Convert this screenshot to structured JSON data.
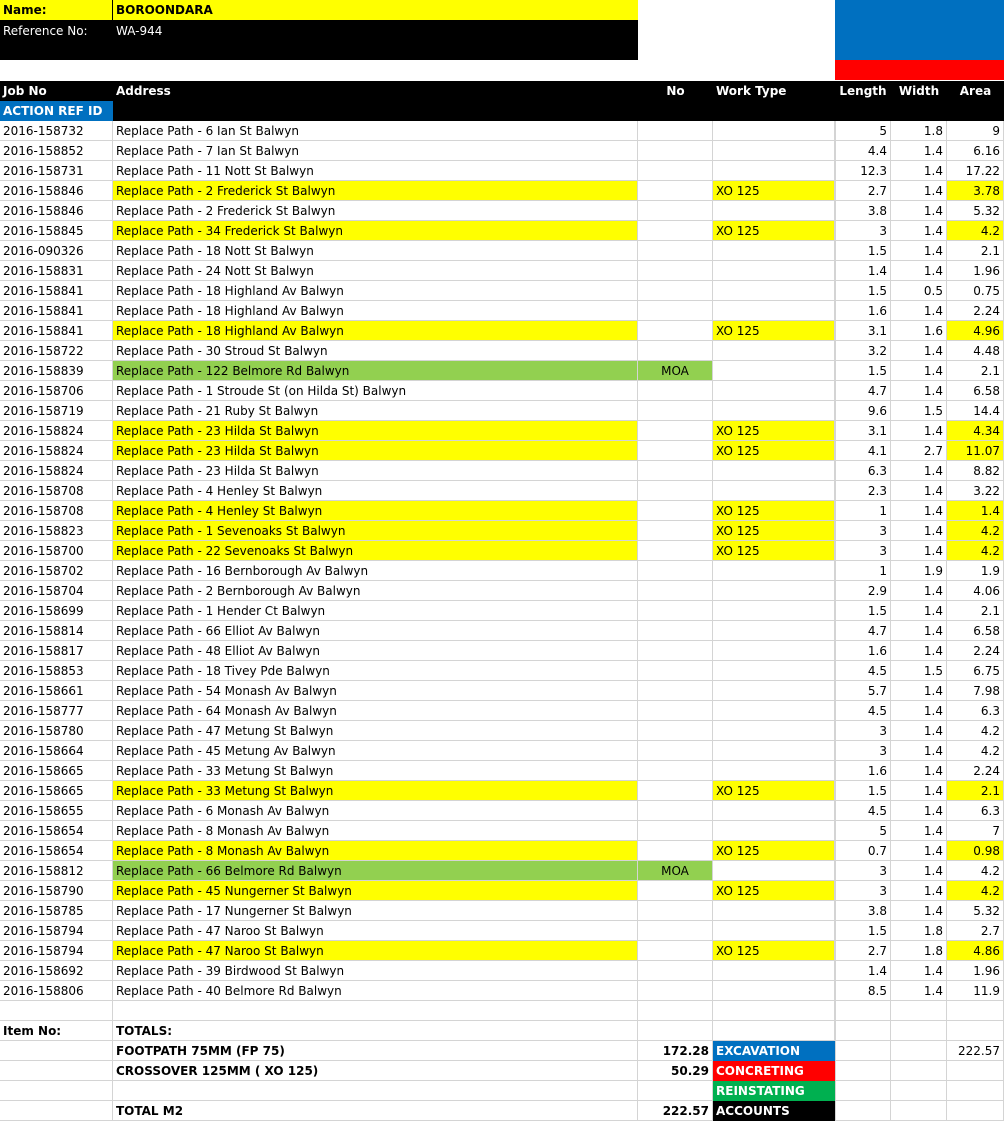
{
  "info": {
    "name_label": "Name:",
    "name_value": "BOROONDARA",
    "ref_label": "Reference No:",
    "ref_value": "WA-944"
  },
  "header": {
    "job_no": "Job No",
    "address": "Address",
    "no": "No",
    "work_type": "Work Type",
    "length": "Length",
    "width": "Width",
    "area": "Area",
    "action_ref": "ACTION REF ID"
  },
  "colors": {
    "yellow": "#ffff00",
    "green": "#92d050",
    "black": "#000000",
    "blue": "#0070c0",
    "red": "#ff0000",
    "reinstating_green": "#00b050"
  },
  "rows": [
    {
      "job": "2016-158732",
      "address": "Replace Path - 6 Ian St Balwyn",
      "no": "",
      "type": "",
      "length": "5",
      "width": "1.8",
      "area": "9",
      "hl": ""
    },
    {
      "job": "2016-158852",
      "address": "Replace Path - 7 Ian St Balwyn",
      "no": "",
      "type": "",
      "length": "4.4",
      "width": "1.4",
      "area": "6.16",
      "hl": ""
    },
    {
      "job": "2016-158731",
      "address": "Replace Path - 11 Nott St Balwyn",
      "no": "",
      "type": "",
      "length": "12.3",
      "width": "1.4",
      "area": "17.22",
      "hl": ""
    },
    {
      "job": "2016-158846",
      "address": "Replace Path - 2 Frederick St Balwyn",
      "no": "",
      "type": "XO 125",
      "length": "2.7",
      "width": "1.4",
      "area": "3.78",
      "hl": "yellow"
    },
    {
      "job": "2016-158846",
      "address": "Replace Path - 2 Frederick St Balwyn",
      "no": "",
      "type": "",
      "length": "3.8",
      "width": "1.4",
      "area": "5.32",
      "hl": ""
    },
    {
      "job": "2016-158845",
      "address": "Replace Path - 34 Frederick St Balwyn",
      "no": "",
      "type": "XO 125",
      "length": "3",
      "width": "1.4",
      "area": "4.2",
      "hl": "yellow"
    },
    {
      "job": "2016-090326",
      "address": "Replace Path - 18 Nott St Balwyn",
      "no": "",
      "type": "",
      "length": "1.5",
      "width": "1.4",
      "area": "2.1",
      "hl": ""
    },
    {
      "job": "2016-158831",
      "address": "Replace Path - 24 Nott St Balwyn",
      "no": "",
      "type": "",
      "length": "1.4",
      "width": "1.4",
      "area": "1.96",
      "hl": ""
    },
    {
      "job": "2016-158841",
      "address": "Replace Path - 18 Highland Av Balwyn",
      "no": "",
      "type": "",
      "length": "1.5",
      "width": "0.5",
      "area": "0.75",
      "hl": ""
    },
    {
      "job": "2016-158841",
      "address": "Replace Path - 18 Highland Av Balwyn",
      "no": "",
      "type": "",
      "length": "1.6",
      "width": "1.4",
      "area": "2.24",
      "hl": ""
    },
    {
      "job": "2016-158841",
      "address": "Replace Path - 18 Highland Av Balwyn",
      "no": "",
      "type": "XO 125",
      "length": "3.1",
      "width": "1.6",
      "area": "4.96",
      "hl": "yellow"
    },
    {
      "job": "2016-158722",
      "address": "Replace Path - 30 Stroud St Balwyn",
      "no": "",
      "type": "",
      "length": "3.2",
      "width": "1.4",
      "area": "4.48",
      "hl": ""
    },
    {
      "job": "2016-158839",
      "address": "Replace Path - 122 Belmore Rd Balwyn",
      "no": "MOA",
      "type": "",
      "length": "1.5",
      "width": "1.4",
      "area": "2.1",
      "hl": "green"
    },
    {
      "job": "2016-158706",
      "address": "Replace Path - 1 Stroude St (on Hilda St) Balwyn",
      "no": "",
      "type": "",
      "length": "4.7",
      "width": "1.4",
      "area": "6.58",
      "hl": ""
    },
    {
      "job": "2016-158719",
      "address": "Replace Path - 21 Ruby St Balwyn",
      "no": "",
      "type": "",
      "length": "9.6",
      "width": "1.5",
      "area": "14.4",
      "hl": ""
    },
    {
      "job": "2016-158824",
      "address": "Replace Path - 23 Hilda St Balwyn",
      "no": "",
      "type": "XO 125",
      "length": "3.1",
      "width": "1.4",
      "area": "4.34",
      "hl": "yellow"
    },
    {
      "job": "2016-158824",
      "address": "Replace Path - 23 Hilda St Balwyn",
      "no": "",
      "type": "XO 125",
      "length": "4.1",
      "width": "2.7",
      "area": "11.07",
      "hl": "yellow"
    },
    {
      "job": "2016-158824",
      "address": "Replace Path - 23 Hilda St Balwyn",
      "no": "",
      "type": "",
      "length": "6.3",
      "width": "1.4",
      "area": "8.82",
      "hl": ""
    },
    {
      "job": "2016-158708",
      "address": "Replace Path - 4 Henley St Balwyn",
      "no": "",
      "type": "",
      "length": "2.3",
      "width": "1.4",
      "area": "3.22",
      "hl": ""
    },
    {
      "job": "2016-158708",
      "address": "Replace Path - 4 Henley St Balwyn",
      "no": "",
      "type": "XO 125",
      "length": "1",
      "width": "1.4",
      "area": "1.4",
      "hl": "yellow"
    },
    {
      "job": "2016-158823",
      "address": "Replace Path - 1 Sevenoaks St Balwyn",
      "no": "",
      "type": "XO 125",
      "length": "3",
      "width": "1.4",
      "area": "4.2",
      "hl": "yellow"
    },
    {
      "job": "2016-158700",
      "address": "Replace Path - 22 Sevenoaks St Balwyn",
      "no": "",
      "type": "XO 125",
      "length": "3",
      "width": "1.4",
      "area": "4.2",
      "hl": "yellow"
    },
    {
      "job": "2016-158702",
      "address": "Replace Path - 16 Bernborough Av Balwyn",
      "no": "",
      "type": "",
      "length": "1",
      "width": "1.9",
      "area": "1.9",
      "hl": ""
    },
    {
      "job": "2016-158704",
      "address": "Replace Path - 2 Bernborough Av Balwyn",
      "no": "",
      "type": "",
      "length": "2.9",
      "width": "1.4",
      "area": "4.06",
      "hl": ""
    },
    {
      "job": "2016-158699",
      "address": "Replace Path - 1 Hender Ct Balwyn",
      "no": "",
      "type": "",
      "length": "1.5",
      "width": "1.4",
      "area": "2.1",
      "hl": ""
    },
    {
      "job": "2016-158814",
      "address": "Replace Path - 66 Elliot Av Balwyn",
      "no": "",
      "type": "",
      "length": "4.7",
      "width": "1.4",
      "area": "6.58",
      "hl": ""
    },
    {
      "job": "2016-158817",
      "address": "Replace Path - 48 Elliot Av Balwyn",
      "no": "",
      "type": "",
      "length": "1.6",
      "width": "1.4",
      "area": "2.24",
      "hl": ""
    },
    {
      "job": "2016-158853",
      "address": "Replace Path - 18 Tivey Pde Balwyn",
      "no": "",
      "type": "",
      "length": "4.5",
      "width": "1.5",
      "area": "6.75",
      "hl": ""
    },
    {
      "job": "2016-158661",
      "address": "Replace Path - 54 Monash Av Balwyn",
      "no": "",
      "type": "",
      "length": "5.7",
      "width": "1.4",
      "area": "7.98",
      "hl": ""
    },
    {
      "job": "2016-158777",
      "address": "Replace Path - 64 Monash Av Balwyn",
      "no": "",
      "type": "",
      "length": "4.5",
      "width": "1.4",
      "area": "6.3",
      "hl": ""
    },
    {
      "job": "2016-158780",
      "address": "Replace Path - 47 Metung St Balwyn",
      "no": "",
      "type": "",
      "length": "3",
      "width": "1.4",
      "area": "4.2",
      "hl": ""
    },
    {
      "job": "2016-158664",
      "address": "Replace Path - 45 Metung Av Balwyn",
      "no": "",
      "type": "",
      "length": "3",
      "width": "1.4",
      "area": "4.2",
      "hl": ""
    },
    {
      "job": "2016-158665",
      "address": "Replace Path - 33 Metung St Balwyn",
      "no": "",
      "type": "",
      "length": "1.6",
      "width": "1.4",
      "area": "2.24",
      "hl": ""
    },
    {
      "job": "2016-158665",
      "address": "Replace Path - 33 Metung St Balwyn",
      "no": "",
      "type": "XO 125",
      "length": "1.5",
      "width": "1.4",
      "area": "2.1",
      "hl": "yellow"
    },
    {
      "job": "2016-158655",
      "address": "Replace Path - 6 Monash Av Balwyn",
      "no": "",
      "type": "",
      "length": "4.5",
      "width": "1.4",
      "area": "6.3",
      "hl": ""
    },
    {
      "job": "2016-158654",
      "address": "Replace Path - 8 Monash Av Balwyn",
      "no": "",
      "type": "",
      "length": "5",
      "width": "1.4",
      "area": "7",
      "hl": ""
    },
    {
      "job": "2016-158654",
      "address": "Replace Path - 8 Monash Av Balwyn",
      "no": "",
      "type": "XO 125",
      "length": "0.7",
      "width": "1.4",
      "area": "0.98",
      "hl": "yellow"
    },
    {
      "job": "2016-158812",
      "address": "Replace Path - 66 Belmore Rd Balwyn",
      "no": "MOA",
      "type": "",
      "length": "3",
      "width": "1.4",
      "area": "4.2",
      "hl": "green"
    },
    {
      "job": "2016-158790",
      "address": "Replace Path - 45 Nungerner St Balwyn",
      "no": "",
      "type": "XO 125",
      "length": "3",
      "width": "1.4",
      "area": "4.2",
      "hl": "yellow"
    },
    {
      "job": "2016-158785",
      "address": "Replace Path - 17 Nungerner St Balwyn",
      "no": "",
      "type": "",
      "length": "3.8",
      "width": "1.4",
      "area": "5.32",
      "hl": ""
    },
    {
      "job": "2016-158794",
      "address": "Replace Path - 47 Naroo St Balwyn",
      "no": "",
      "type": "",
      "length": "1.5",
      "width": "1.8",
      "area": "2.7",
      "hl": ""
    },
    {
      "job": "2016-158794",
      "address": "Replace Path - 47 Naroo St Balwyn",
      "no": "",
      "type": "XO 125",
      "length": "2.7",
      "width": "1.8",
      "area": "4.86",
      "hl": "yellow"
    },
    {
      "job": "2016-158692",
      "address": "Replace Path - 39 Birdwood St Balwyn",
      "no": "",
      "type": "",
      "length": "1.4",
      "width": "1.4",
      "area": "1.96",
      "hl": ""
    },
    {
      "job": "2016-158806",
      "address": "Replace Path - 40 Belmore Rd Balwyn",
      "no": "",
      "type": "",
      "length": "8.5",
      "width": "1.4",
      "area": "11.9",
      "hl": ""
    }
  ],
  "totals": {
    "item_no_label": "Item No:",
    "totals_label": "TOTALS:",
    "footpath_label": "FOOTPATH 75MM (FP 75)",
    "footpath_value": "172.28",
    "crossover_label": "CROSSOVER 125MM  ( XO 125)",
    "crossover_value": "50.29",
    "total_label": "TOTAL M2",
    "total_value": "222.57",
    "excavation_label": "EXCAVATION",
    "excavation_area": "222.57",
    "concreting_label": "CONCRETING",
    "reinstating_label": "REINSTATING",
    "accounts_label": "ACCOUNTS"
  }
}
